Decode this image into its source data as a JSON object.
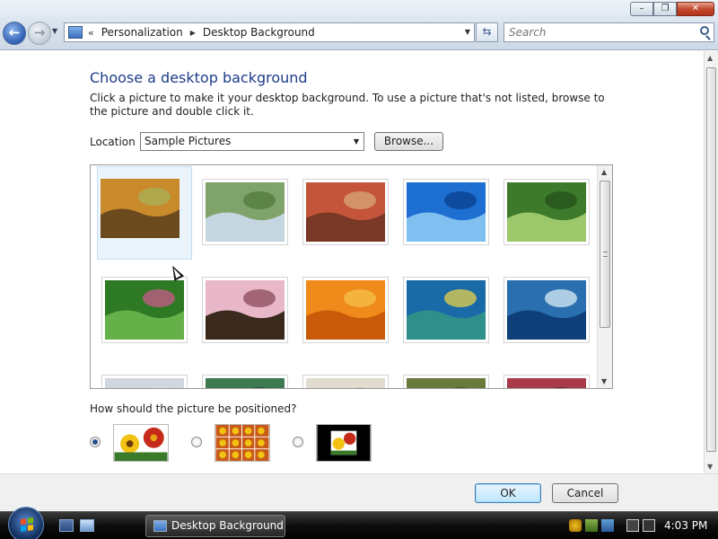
{
  "window": {
    "minimize_glyph": "–",
    "maximize_glyph": "❐",
    "close_glyph": "✕"
  },
  "nav": {
    "back_glyph": "←",
    "forward_glyph": "→",
    "chevron": "«",
    "breadcrumbs": [
      "Personalization",
      "Desktop Background"
    ],
    "crumb_separator": "▶",
    "dropdown_glyph": "▼",
    "refresh_glyph": "⇆"
  },
  "search": {
    "placeholder": "Search"
  },
  "main": {
    "title": "Choose a desktop background",
    "intro": "Click a picture to make it your desktop background. To use a picture that's not listed, browse to the picture and double click it.",
    "location_label": "Location",
    "location_value": "Sample Pictures",
    "browse_label": "Browse...",
    "position_label": "How should the picture be positioned?",
    "position_options": [
      {
        "name": "fit-to-screen",
        "checked": true
      },
      {
        "name": "tile",
        "checked": false
      },
      {
        "name": "center",
        "checked": false
      }
    ],
    "gallery": {
      "selected_index": 0,
      "items": [
        {
          "name": "autumn-tree",
          "colors": [
            "#c98a2b",
            "#6b4a1e",
            "#a6b25a"
          ]
        },
        {
          "name": "green-stream",
          "colors": [
            "#7fa36b",
            "#c5d6e0",
            "#4f7a3a"
          ]
        },
        {
          "name": "desert-mesa",
          "colors": [
            "#c4553a",
            "#7a3826",
            "#d9a77a"
          ]
        },
        {
          "name": "blue-pier",
          "colors": [
            "#1d6fd1",
            "#7fc0f0",
            "#0a3f8c"
          ]
        },
        {
          "name": "forest-path",
          "colors": [
            "#3d7a2b",
            "#9cc86b",
            "#25501c"
          ]
        },
        {
          "name": "green-ferns",
          "colors": [
            "#2e7a24",
            "#66b04a",
            "#c85a8a"
          ]
        },
        {
          "name": "pink-flowers",
          "colors": [
            "#e8b7c8",
            "#3a2a1e",
            "#8a4a5a"
          ]
        },
        {
          "name": "orange-daisies",
          "colors": [
            "#f08a1a",
            "#c85a0a",
            "#f4c048"
          ]
        },
        {
          "name": "sea-turtle",
          "colors": [
            "#1a6aa8",
            "#2f8f8a",
            "#e8d24a"
          ]
        },
        {
          "name": "whale-tail",
          "colors": [
            "#2a6fb0",
            "#0f3f78",
            "#d9ecf7"
          ]
        },
        {
          "name": "partial-row-1",
          "colors": [
            "#cfd6de",
            "#9aa5b0",
            "#e6e8ea"
          ]
        },
        {
          "name": "partial-row-2",
          "colors": [
            "#3d7a52",
            "#6a9a7a",
            "#203a2a"
          ]
        },
        {
          "name": "partial-row-3",
          "colors": [
            "#e0ddd0",
            "#8a8a6a",
            "#c8c0a8"
          ]
        },
        {
          "name": "partial-row-4",
          "colors": [
            "#6a7a3a",
            "#a8a060",
            "#3a4a20"
          ]
        },
        {
          "name": "partial-row-5",
          "colors": [
            "#a83a4a",
            "#d86a7a",
            "#5a1a2a"
          ]
        }
      ]
    }
  },
  "footer": {
    "ok_label": "OK",
    "cancel_label": "Cancel"
  },
  "taskbar": {
    "active_window": "Desktop Background",
    "clock": "4:03 PM"
  },
  "colors": {
    "title_blue": "#1e3c8a",
    "ok_accent": "#3c7fb1",
    "selection_bg": "#eaf4fc"
  }
}
